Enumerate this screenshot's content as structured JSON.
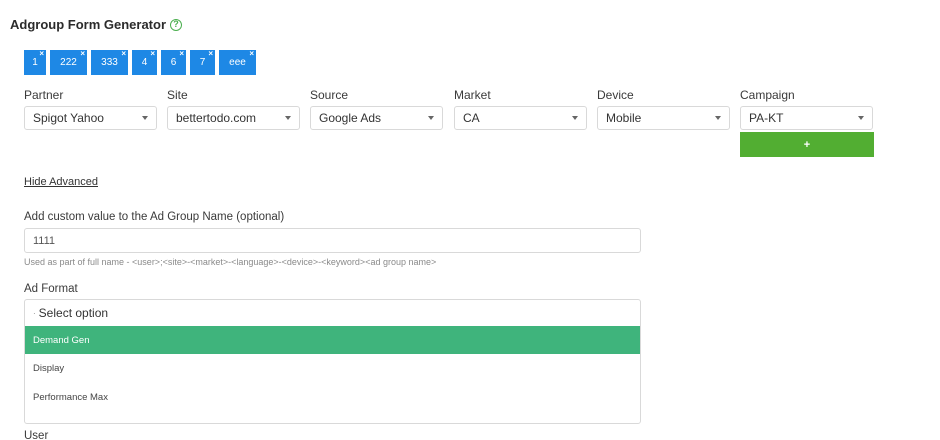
{
  "header": {
    "title": "Adgroup Form Generator",
    "help_glyph": "?"
  },
  "tags": [
    {
      "label": "1"
    },
    {
      "label": "222"
    },
    {
      "label": "333"
    },
    {
      "label": "4"
    },
    {
      "label": "6"
    },
    {
      "label": "7"
    },
    {
      "label": "eee"
    }
  ],
  "tag_remove_glyph": "×",
  "fields": {
    "partner": {
      "label": "Partner",
      "value": "Spigot Yahoo"
    },
    "site": {
      "label": "Site",
      "value": "bettertodo.com"
    },
    "source": {
      "label": "Source",
      "value": "Google Ads"
    },
    "market": {
      "label": "Market",
      "value": "CA"
    },
    "device": {
      "label": "Device",
      "value": "Mobile"
    },
    "campaign": {
      "label": "Campaign",
      "value": "PA-KT"
    }
  },
  "add_button": {
    "label": "+"
  },
  "advanced": {
    "toggle_label": "Hide Advanced"
  },
  "custom_name": {
    "label": "Add custom value to the Ad Group Name (optional)",
    "value": "1111",
    "hint": "Used as part of full name - <user>;<site>-<market>-<language>-<device>-<keyword><ad group name>"
  },
  "ad_format": {
    "label": "Ad Format",
    "placeholder": "Select option",
    "options": [
      "Demand Gen",
      "Display",
      "Performance Max"
    ],
    "highlighted": "Demand Gen"
  },
  "user": {
    "label": "User"
  },
  "colors": {
    "tag": "#1e88e5",
    "add_button": "#52ae32",
    "highlight": "#3fb47c",
    "help_icon": "#4caf50"
  }
}
